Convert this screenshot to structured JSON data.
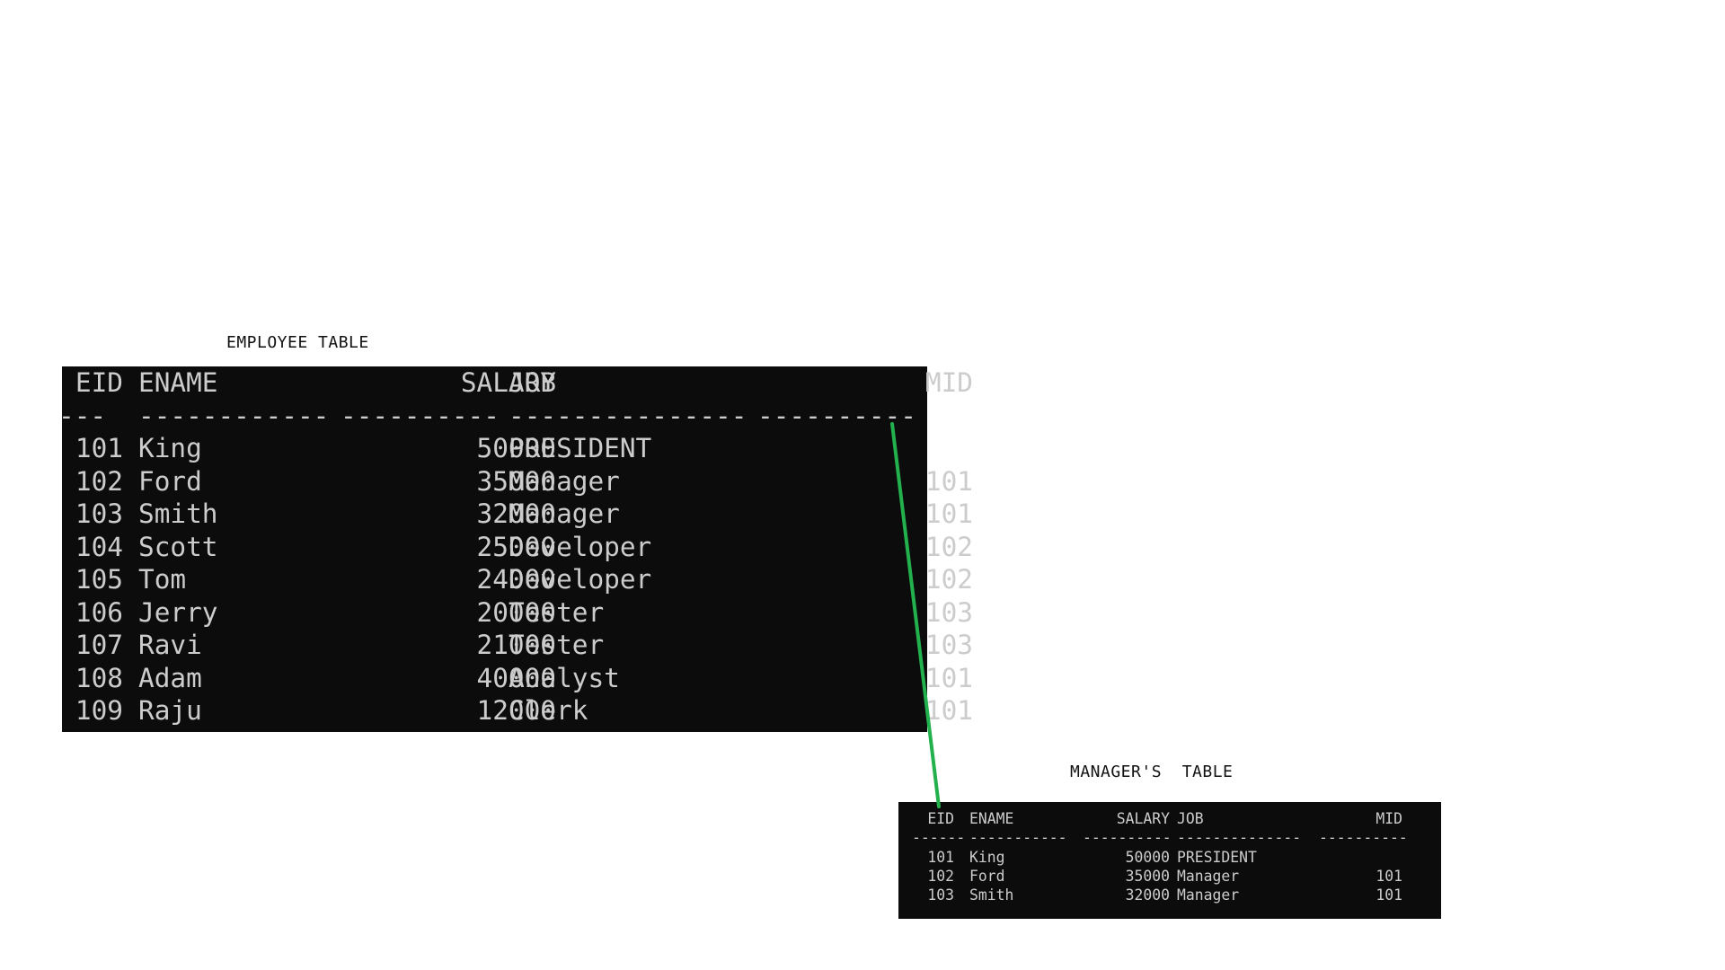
{
  "employee_caption": "EMPLOYEE TABLE",
  "manager_caption": "MANAGER'S  TABLE",
  "connector_color": "#22b14c",
  "employee_table": {
    "headers": [
      "EID",
      "ENAME",
      "SALARY",
      "JOB",
      "MID"
    ],
    "dashes": [
      "---",
      "------------",
      "----------",
      "---------------",
      "----------"
    ],
    "rows": [
      [
        "101",
        "King",
        "50000",
        "PRESIDENT",
        ""
      ],
      [
        "102",
        "Ford",
        "35000",
        "Manager",
        "101"
      ],
      [
        "103",
        "Smith",
        "32000",
        "Manager",
        "101"
      ],
      [
        "104",
        "Scott",
        "25000",
        "Developer",
        "102"
      ],
      [
        "105",
        "Tom",
        "24000",
        "Developer",
        "102"
      ],
      [
        "106",
        "Jerry",
        "20000",
        "Tester",
        "103"
      ],
      [
        "107",
        "Ravi",
        "21000",
        "Tester",
        "103"
      ],
      [
        "108",
        "Adam",
        "40000",
        "Analyst",
        "101"
      ],
      [
        "109",
        "Raju",
        "12000",
        "Clerk",
        "101"
      ]
    ]
  },
  "manager_table": {
    "headers": [
      "EID",
      "ENAME",
      "SALARY",
      "JOB",
      "MID"
    ],
    "dashes": [
      "------",
      "-----------",
      "----------",
      "--------------",
      "----------"
    ],
    "rows": [
      [
        "101",
        "King",
        "50000",
        "PRESIDENT",
        ""
      ],
      [
        "102",
        "Ford",
        "35000",
        "Manager",
        "101"
      ],
      [
        "103",
        "Smith",
        "32000",
        "Manager",
        "101"
      ]
    ]
  }
}
